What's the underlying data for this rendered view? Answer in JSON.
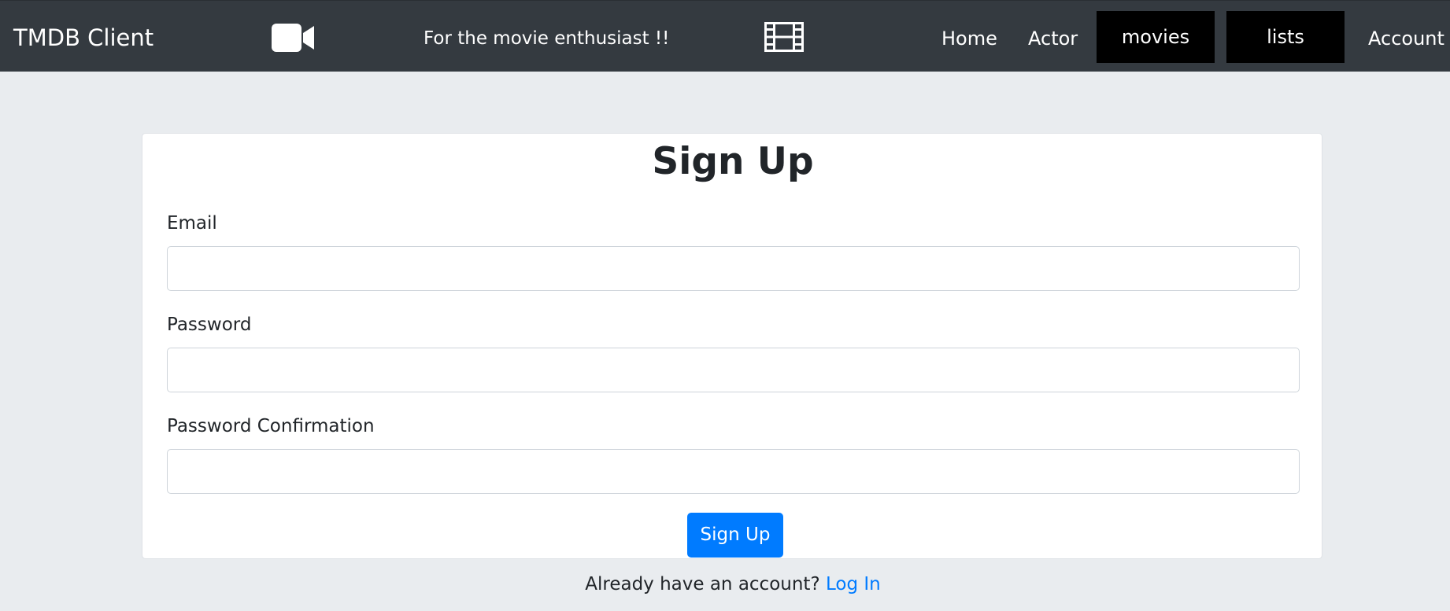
{
  "navbar": {
    "brand": "TMDB Client",
    "tagline": "For the movie enthusiast !!",
    "icons": {
      "left": "video-camera-icon",
      "right": "film-strip-icon"
    },
    "links": {
      "home": "Home",
      "actor": "Actor",
      "movies": "movies",
      "lists": "lists",
      "account": "Account"
    },
    "colors": {
      "background": "#343a40",
      "highlight_block": "#000000",
      "text": "#ffffff"
    }
  },
  "form": {
    "title": "Sign Up",
    "fields": {
      "email": {
        "label": "Email",
        "value": "",
        "placeholder": ""
      },
      "password": {
        "label": "Password",
        "value": "",
        "placeholder": ""
      },
      "password_confirmation": {
        "label": "Password Confirmation",
        "value": "",
        "placeholder": ""
      }
    },
    "submit_label": "Sign Up",
    "accent_color": "#007bff"
  },
  "footer": {
    "prompt": "Already have an account?",
    "login_link": "Log In"
  }
}
